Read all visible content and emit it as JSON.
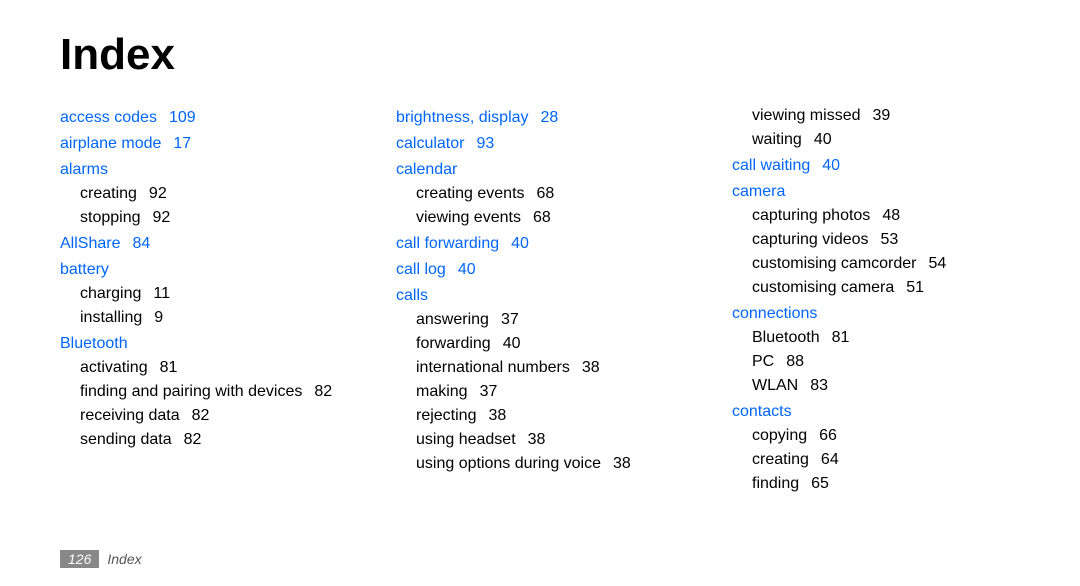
{
  "title": "Index",
  "footer": {
    "pageNumber": "126",
    "label": "Index"
  },
  "columns": [
    [
      {
        "type": "main",
        "term": "access codes",
        "page": "109"
      },
      {
        "type": "main",
        "term": "airplane mode",
        "page": "17"
      },
      {
        "type": "main",
        "term": "alarms"
      },
      {
        "type": "sub",
        "term": "creating",
        "page": "92"
      },
      {
        "type": "sub",
        "term": "stopping",
        "page": "92"
      },
      {
        "type": "main",
        "term": "AllShare",
        "page": "84"
      },
      {
        "type": "main",
        "term": "battery"
      },
      {
        "type": "sub",
        "term": "charging",
        "page": "11"
      },
      {
        "type": "sub",
        "term": "installing",
        "page": "9"
      },
      {
        "type": "main",
        "term": "Bluetooth"
      },
      {
        "type": "sub",
        "term": "activating",
        "page": "81"
      },
      {
        "type": "sub",
        "term": "finding and pairing with devices",
        "page": "82"
      },
      {
        "type": "sub",
        "term": "receiving data",
        "page": "82"
      },
      {
        "type": "sub",
        "term": "sending data",
        "page": "82"
      }
    ],
    [
      {
        "type": "main",
        "term": "brightness, display",
        "page": "28"
      },
      {
        "type": "main",
        "term": "calculator",
        "page": "93"
      },
      {
        "type": "main",
        "term": "calendar"
      },
      {
        "type": "sub",
        "term": "creating events",
        "page": "68"
      },
      {
        "type": "sub",
        "term": "viewing events",
        "page": "68"
      },
      {
        "type": "main",
        "term": "call forwarding",
        "page": "40"
      },
      {
        "type": "main",
        "term": "call log",
        "page": "40"
      },
      {
        "type": "main",
        "term": "calls"
      },
      {
        "type": "sub",
        "term": "answering",
        "page": "37"
      },
      {
        "type": "sub",
        "term": "forwarding",
        "page": "40"
      },
      {
        "type": "sub",
        "term": "international numbers",
        "page": "38"
      },
      {
        "type": "sub",
        "term": "making",
        "page": "37"
      },
      {
        "type": "sub",
        "term": "rejecting",
        "page": "38"
      },
      {
        "type": "sub",
        "term": "using headset",
        "page": "38"
      },
      {
        "type": "sub",
        "term": "using options during voice",
        "page": "38"
      }
    ],
    [
      {
        "type": "sub",
        "term": "viewing missed",
        "page": "39"
      },
      {
        "type": "sub",
        "term": "waiting",
        "page": "40"
      },
      {
        "type": "main",
        "term": "call waiting",
        "page": "40"
      },
      {
        "type": "main",
        "term": "camera"
      },
      {
        "type": "sub",
        "term": "capturing photos",
        "page": "48"
      },
      {
        "type": "sub",
        "term": "capturing videos",
        "page": "53"
      },
      {
        "type": "sub",
        "term": "customising camcorder",
        "page": "54"
      },
      {
        "type": "sub",
        "term": "customising camera",
        "page": "51"
      },
      {
        "type": "main",
        "term": "connections"
      },
      {
        "type": "sub",
        "term": "Bluetooth",
        "page": "81"
      },
      {
        "type": "sub",
        "term": "PC",
        "page": "88"
      },
      {
        "type": "sub",
        "term": "WLAN",
        "page": "83"
      },
      {
        "type": "main",
        "term": "contacts"
      },
      {
        "type": "sub",
        "term": "copying",
        "page": "66"
      },
      {
        "type": "sub",
        "term": "creating",
        "page": "64"
      },
      {
        "type": "sub",
        "term": "finding",
        "page": "65"
      }
    ]
  ]
}
